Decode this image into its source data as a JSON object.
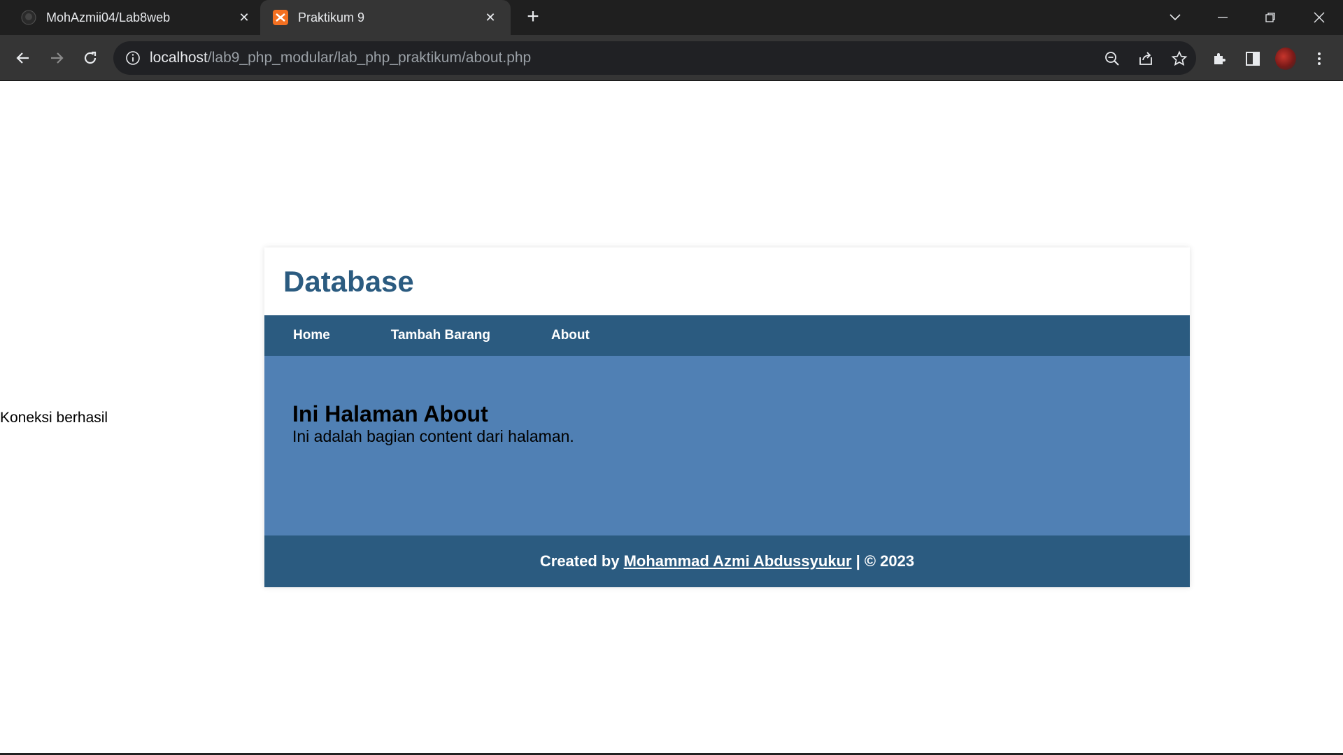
{
  "browser": {
    "tabs": [
      {
        "title": "MohAzmii04/Lab8web",
        "active": false,
        "icon": "github-icon"
      },
      {
        "title": "Praktikum 9",
        "active": true,
        "icon": "xampp-icon"
      }
    ],
    "url_host": "localhost",
    "url_path": "/lab9_php_modular/lab_php_praktikum/about.php"
  },
  "page": {
    "connection_status": "Koneksi berhasil",
    "site_title": "Database",
    "nav": [
      {
        "label": "Home"
      },
      {
        "label": "Tambah Barang"
      },
      {
        "label": "About"
      }
    ],
    "content": {
      "heading": "Ini Halaman About",
      "text": "Ini adalah bagian content dari halaman."
    },
    "footer": {
      "prefix": "Created by",
      "author": "Mohammad Azmi Abdussyukur",
      "suffix": "| © 2023"
    }
  },
  "colors": {
    "header_blue": "#2b5b80",
    "content_blue": "#5080b4"
  }
}
